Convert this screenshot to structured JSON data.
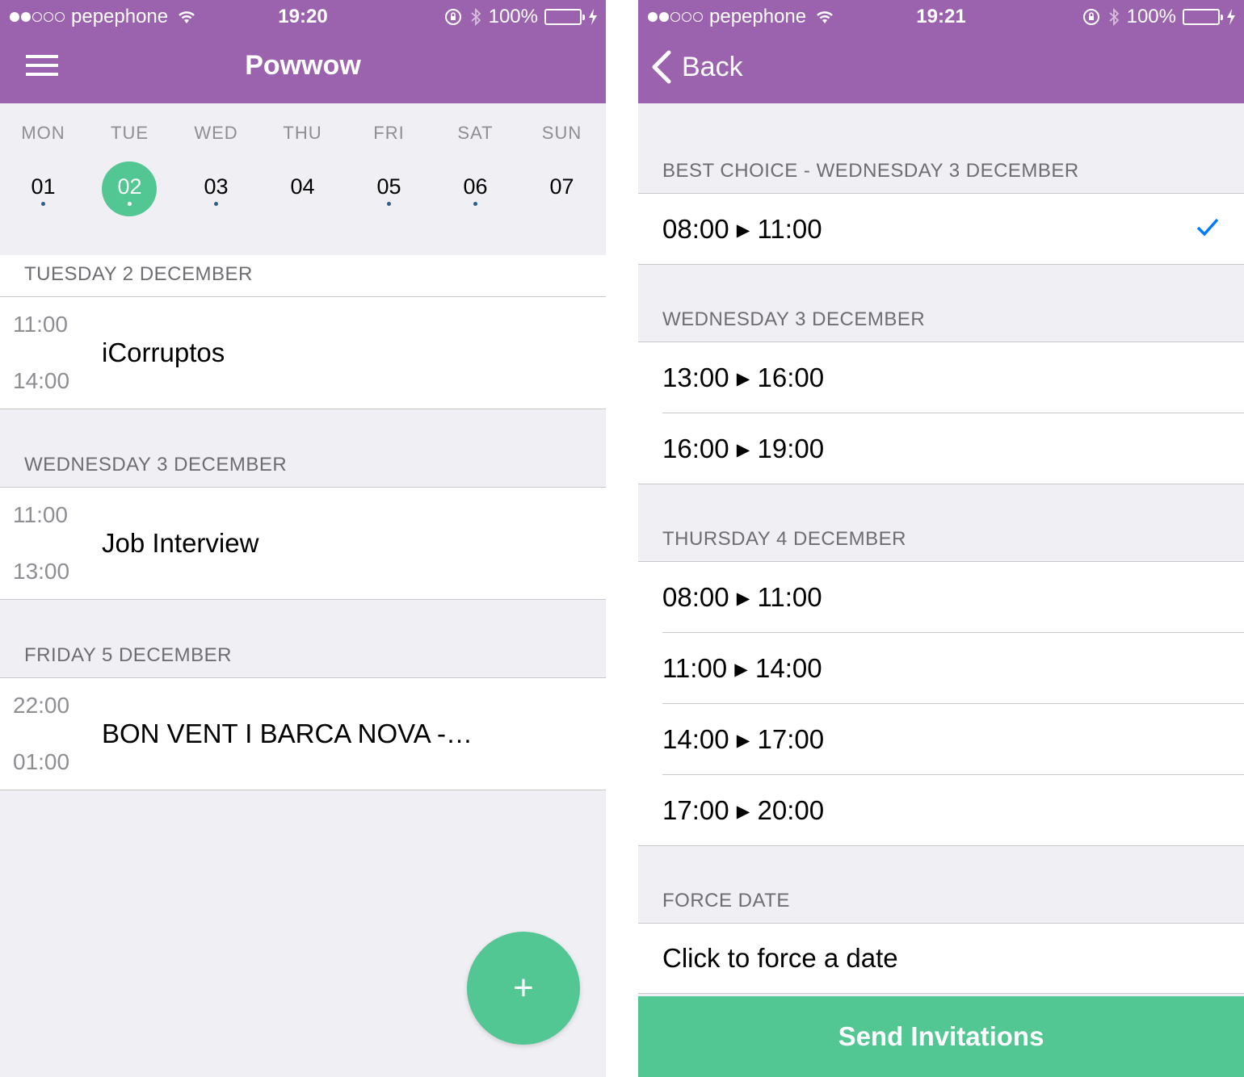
{
  "left": {
    "status": {
      "carrier": "pepephone",
      "time": "19:20",
      "battery": "100%"
    },
    "nav": {
      "title": "Powwow"
    },
    "week": [
      {
        "name": "MON",
        "num": "01",
        "has_event": true,
        "selected": false
      },
      {
        "name": "TUE",
        "num": "02",
        "has_event": true,
        "selected": true
      },
      {
        "name": "WED",
        "num": "03",
        "has_event": true,
        "selected": false
      },
      {
        "name": "THU",
        "num": "04",
        "has_event": false,
        "selected": false
      },
      {
        "name": "FRI",
        "num": "05",
        "has_event": true,
        "selected": false
      },
      {
        "name": "SAT",
        "num": "06",
        "has_event": true,
        "selected": false
      },
      {
        "name": "SUN",
        "num": "07",
        "has_event": false,
        "selected": false
      }
    ],
    "sections": [
      {
        "header": "TUESDAY 2 DECEMBER",
        "event": {
          "start": "11:00",
          "end": "14:00",
          "title": "iCorruptos"
        }
      },
      {
        "header": "WEDNESDAY 3 DECEMBER",
        "event": {
          "start": "11:00",
          "end": "13:00",
          "title": "Job Interview"
        }
      },
      {
        "header": "FRIDAY 5 DECEMBER",
        "event": {
          "start": "22:00",
          "end": "01:00",
          "title": "BON VENT I BARCA NOVA -…"
        }
      }
    ],
    "fab_label": "+"
  },
  "right": {
    "status": {
      "carrier": "pepephone",
      "time": "19:21",
      "battery": "100%"
    },
    "nav": {
      "back_label": "Back"
    },
    "groups": [
      {
        "header": "BEST CHOICE - WEDNESDAY 3 DECEMBER",
        "slots": [
          {
            "from": "08:00",
            "to": "11:00",
            "selected": true
          }
        ]
      },
      {
        "header": "WEDNESDAY 3 DECEMBER",
        "slots": [
          {
            "from": "13:00",
            "to": "16:00"
          },
          {
            "from": "16:00",
            "to": "19:00"
          }
        ]
      },
      {
        "header": "THURSDAY 4 DECEMBER",
        "slots": [
          {
            "from": "08:00",
            "to": "11:00"
          },
          {
            "from": "11:00",
            "to": "14:00"
          },
          {
            "from": "14:00",
            "to": "17:00"
          },
          {
            "from": "17:00",
            "to": "20:00"
          }
        ]
      }
    ],
    "force": {
      "header": "FORCE DATE",
      "label": "Click to force a date"
    },
    "send_button": "Send Invitations"
  },
  "colors": {
    "brand_purple": "#9b63ad",
    "accent_green": "#52c693",
    "check_blue": "#007aff"
  }
}
